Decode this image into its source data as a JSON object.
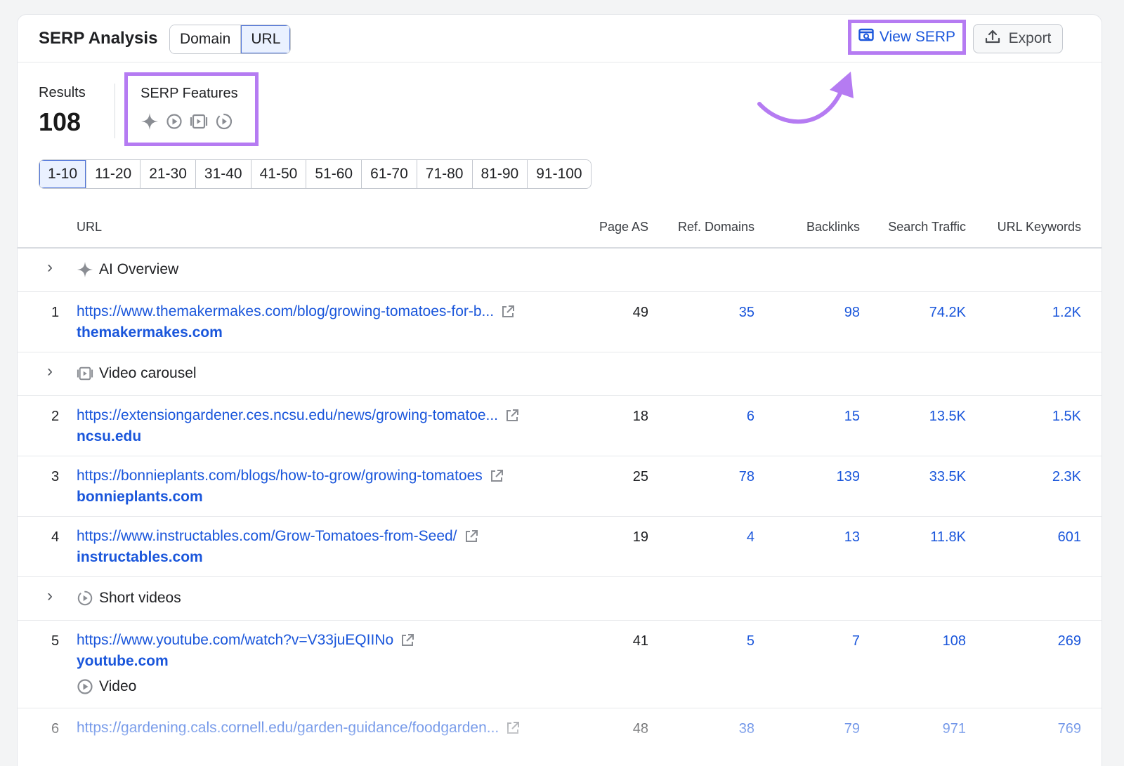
{
  "header": {
    "title": "SERP Analysis",
    "toggle": [
      "Domain",
      "URL"
    ],
    "active_toggle": "URL",
    "view_serp_label": "View SERP",
    "export_label": "Export"
  },
  "summary": {
    "results_label": "Results",
    "results_count": "108",
    "features_label": "SERP Features",
    "feature_icons": [
      "ai-overview-icon",
      "video-icon",
      "video-carousel-icon",
      "short-videos-icon"
    ]
  },
  "pagination": [
    "1-10",
    "11-20",
    "21-30",
    "31-40",
    "41-50",
    "51-60",
    "61-70",
    "71-80",
    "81-90",
    "91-100"
  ],
  "columns": {
    "url": "URL",
    "page_as": "Page AS",
    "ref_domains": "Ref. Domains",
    "backlinks": "Backlinks",
    "search_traffic": "Search Traffic",
    "url_keywords": "URL Keywords"
  },
  "groups": {
    "ai_overview": "AI Overview",
    "video_carousel": "Video carousel",
    "short_videos": "Short videos"
  },
  "rows": [
    {
      "rank": "1",
      "url": "https://www.themakermakes.com/blog/growing-tomatoes-for-b...",
      "domain": "themakermakes.com",
      "page_as": "49",
      "ref_domains": "35",
      "backlinks": "98",
      "search_traffic": "74.2K",
      "url_keywords": "1.2K"
    },
    {
      "rank": "2",
      "url": "https://extensiongardener.ces.ncsu.edu/news/growing-tomatoe...",
      "domain": "ncsu.edu",
      "page_as": "18",
      "ref_domains": "6",
      "backlinks": "15",
      "search_traffic": "13.5K",
      "url_keywords": "1.5K"
    },
    {
      "rank": "3",
      "url": "https://bonnieplants.com/blogs/how-to-grow/growing-tomatoes",
      "domain": "bonnieplants.com",
      "page_as": "25",
      "ref_domains": "78",
      "backlinks": "139",
      "search_traffic": "33.5K",
      "url_keywords": "2.3K"
    },
    {
      "rank": "4",
      "url": "https://www.instructables.com/Grow-Tomatoes-from-Seed/",
      "domain": "instructables.com",
      "page_as": "19",
      "ref_domains": "4",
      "backlinks": "13",
      "search_traffic": "11.8K",
      "url_keywords": "601"
    },
    {
      "rank": "5",
      "url": "https://www.youtube.com/watch?v=V33juEQIINo",
      "domain": "youtube.com",
      "feature": "Video",
      "page_as": "41",
      "ref_domains": "5",
      "backlinks": "7",
      "search_traffic": "108",
      "url_keywords": "269"
    },
    {
      "rank": "6",
      "url": "https://gardening.cals.cornell.edu/garden-guidance/foodgarden...",
      "page_as": "48",
      "ref_domains": "38",
      "backlinks": "79",
      "search_traffic": "971",
      "url_keywords": "769"
    }
  ],
  "colors": {
    "highlight": "#b57bf2",
    "link": "#1a56db",
    "active_bg": "#eaf1ff"
  }
}
